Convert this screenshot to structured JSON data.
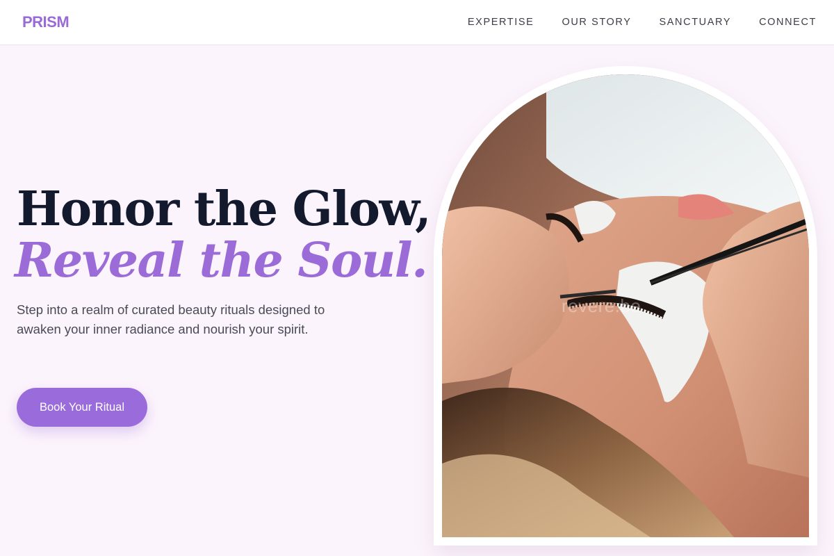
{
  "brand": {
    "name": "PRISM",
    "color": "#9a6ad6"
  },
  "nav": {
    "links": [
      {
        "label": "EXPERTISE"
      },
      {
        "label": "OUR STORY"
      },
      {
        "label": "SANCTUARY"
      },
      {
        "label": "CONNECT"
      }
    ]
  },
  "hero": {
    "headline_line1": "Honor the Glow,",
    "headline_line2": "Reveal the Soul.",
    "subtitle": "Step into a realm of curated beauty rituals designed to awaken your inner radiance and nourish your spirit.",
    "cta_label": "Book Your Ritual",
    "image": {
      "description_icon": "eyelash-extension-photo",
      "watermark": "revere.be"
    }
  },
  "colors": {
    "accent": "#9a6cdb",
    "heading": "#141a2e",
    "background": "#fcf4fc",
    "body_text": "#4a4a56"
  }
}
